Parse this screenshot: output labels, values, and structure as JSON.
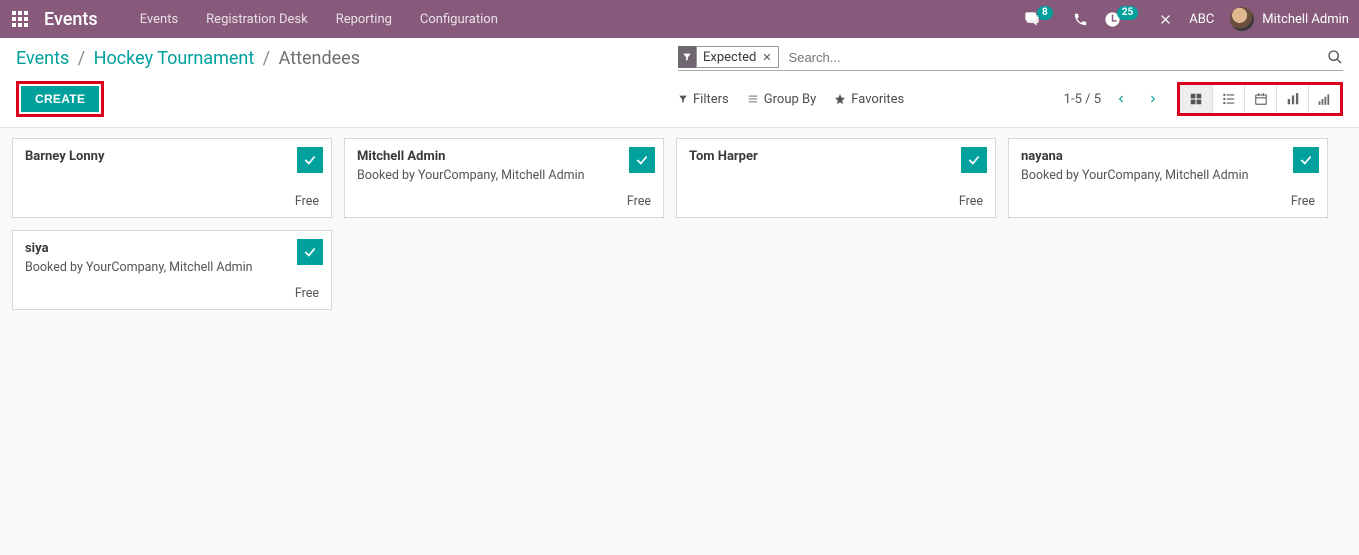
{
  "topnav": {
    "brand": "Events",
    "menu": [
      "Events",
      "Registration Desk",
      "Reporting",
      "Configuration"
    ],
    "msg_badge": "8",
    "activity_badge": "25",
    "company": "ABC",
    "user": "Mitchell Admin"
  },
  "breadcrumb": {
    "root": "Events",
    "parent": "Hockey Tournament",
    "current": "Attendees"
  },
  "search": {
    "chip": "Expected",
    "placeholder": "Search..."
  },
  "buttons": {
    "create": "CREATE"
  },
  "toolbar": {
    "filters": "Filters",
    "groupby": "Group By",
    "favorites": "Favorites",
    "pager": "1-5 / 5"
  },
  "cards": [
    {
      "name": "Barney Lonny",
      "sub": "",
      "price": "Free"
    },
    {
      "name": "Mitchell Admin",
      "sub": "Booked by YourCompany, Mitchell Admin",
      "price": "Free"
    },
    {
      "name": "Tom Harper",
      "sub": "",
      "price": "Free"
    },
    {
      "name": "nayana",
      "sub": "Booked by YourCompany, Mitchell Admin",
      "price": "Free"
    },
    {
      "name": "siya",
      "sub": "Booked by YourCompany, Mitchell Admin",
      "price": "Free"
    }
  ]
}
